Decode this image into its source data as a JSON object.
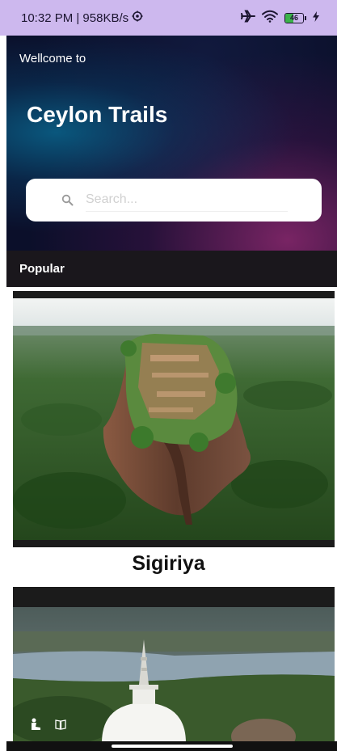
{
  "status_bar": {
    "time_speed": "10:32 PM | 958KB/s",
    "battery_level": "46",
    "battery_fraction": 0.46,
    "icons": [
      "vpn-key-icon",
      "airplane-icon",
      "wifi-icon",
      "battery-icon",
      "charging-icon"
    ]
  },
  "hero": {
    "welcome": "Wellcome to",
    "title": "Ceylon Trails"
  },
  "search": {
    "placeholder": "Search...",
    "value": ""
  },
  "section": {
    "popular": "Popular"
  },
  "places": [
    {
      "name": "Sigiriya"
    },
    {
      "name": ""
    }
  ],
  "colors": {
    "status_bar_bg": "#cdb8ee",
    "hero_bg": "#0b0f2a",
    "section_bar_bg": "#1a171c",
    "card_frame": "#1b1b1b"
  }
}
